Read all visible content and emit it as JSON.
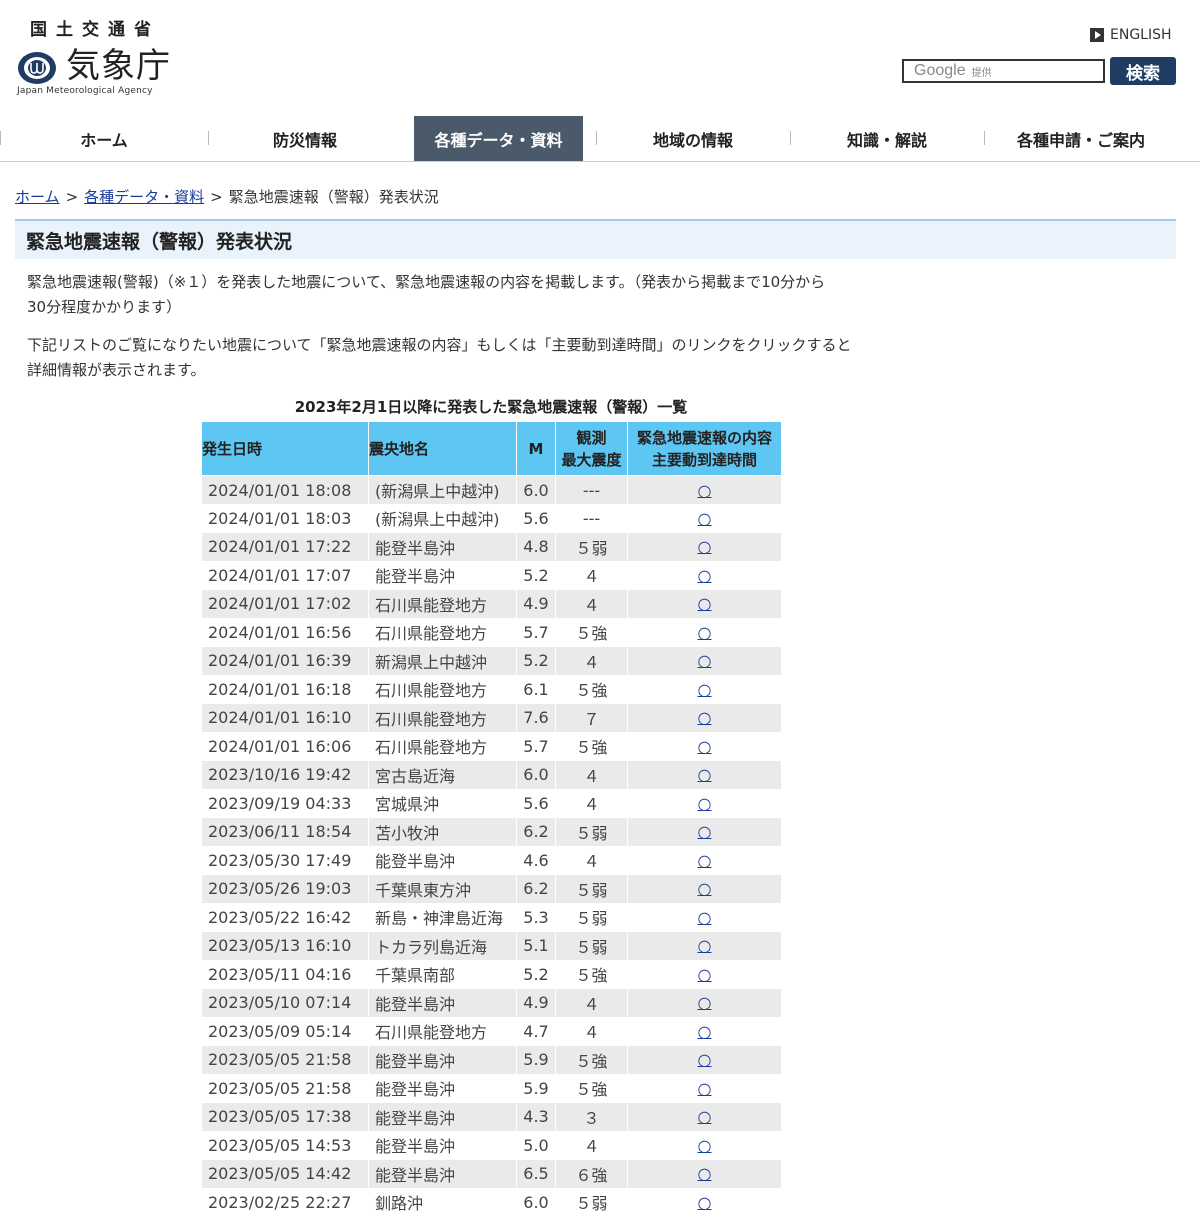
{
  "header": {
    "ministry": "国土交通省",
    "agency_name": "気象庁",
    "agency_en": "Japan Meteorological Agency",
    "english_label": "ENGLISH",
    "search": {
      "google_word": "Google",
      "google_sub": "提供",
      "button_label": "検索"
    },
    "colors": {
      "logo": "#1f3d63",
      "search_button": "#1f3d63"
    }
  },
  "nav": {
    "items": [
      {
        "label": "ホーム"
      },
      {
        "label": "防災情報"
      },
      {
        "label": "各種データ・資料"
      },
      {
        "label": "地域の情報"
      },
      {
        "label": "知識・解説"
      },
      {
        "label": "各種申請・ご案内"
      }
    ],
    "active_index": 2,
    "active_color": "#4b5a6b"
  },
  "breadcrumb": {
    "home": "ホーム",
    "sep1": ">",
    "data": "各種データ・資料",
    "sep2": ">",
    "current": "緊急地震速報（警報）発表状況"
  },
  "page": {
    "title": "緊急地震速報（警報）発表状況",
    "para1_line1": "緊急地震速報(警報)（※１）を発表した地震について、緊急地震速報の内容を掲載します。（発表から掲載まで10分から",
    "para1_line2": "30分程度かかります）",
    "para2_line1": "下記リストのご覧になりたい地震について「緊急地震速報の内容」もしくは「主要動到達時間」のリンクをクリックすると",
    "para2_line2": "詳細情報が表示されます。"
  },
  "table": {
    "caption": "2023年2月1日以降に発表した緊急地震速報（警報）一覧",
    "header_color": "#5ec6f2",
    "headers": {
      "datetime": "発生日時",
      "epicenter": "震央地名",
      "magnitude": "M",
      "intensity_line1": "観測",
      "intensity_line2": "最大震度",
      "link_line1": "緊急地震速報の内容",
      "link_line2": "主要動到達時間"
    },
    "rows": [
      {
        "datetime": "2024/01/01 18:08",
        "epicenter": "(新潟県上中越沖)",
        "m": "6.0",
        "intensity": "---",
        "link": "○"
      },
      {
        "datetime": "2024/01/01 18:03",
        "epicenter": "(新潟県上中越沖)",
        "m": "5.6",
        "intensity": "---",
        "link": "○"
      },
      {
        "datetime": "2024/01/01 17:22",
        "epicenter": "能登半島沖",
        "m": "4.8",
        "intensity": "５弱",
        "link": "○"
      },
      {
        "datetime": "2024/01/01 17:07",
        "epicenter": "能登半島沖",
        "m": "5.2",
        "intensity": "４",
        "link": "○"
      },
      {
        "datetime": "2024/01/01 17:02",
        "epicenter": "石川県能登地方",
        "m": "4.9",
        "intensity": "４",
        "link": "○"
      },
      {
        "datetime": "2024/01/01 16:56",
        "epicenter": "石川県能登地方",
        "m": "5.7",
        "intensity": "５強",
        "link": "○"
      },
      {
        "datetime": "2024/01/01 16:39",
        "epicenter": "新潟県上中越沖",
        "m": "5.2",
        "intensity": "４",
        "link": "○"
      },
      {
        "datetime": "2024/01/01 16:18",
        "epicenter": "石川県能登地方",
        "m": "6.1",
        "intensity": "５強",
        "link": "○"
      },
      {
        "datetime": "2024/01/01 16:10",
        "epicenter": "石川県能登地方",
        "m": "7.6",
        "intensity": "７",
        "link": "○"
      },
      {
        "datetime": "2024/01/01 16:06",
        "epicenter": "石川県能登地方",
        "m": "5.7",
        "intensity": "５強",
        "link": "○"
      },
      {
        "datetime": "2023/10/16 19:42",
        "epicenter": "宮古島近海",
        "m": "6.0",
        "intensity": "４",
        "link": "○"
      },
      {
        "datetime": "2023/09/19 04:33",
        "epicenter": "宮城県沖",
        "m": "5.6",
        "intensity": "４",
        "link": "○"
      },
      {
        "datetime": "2023/06/11 18:54",
        "epicenter": "苫小牧沖",
        "m": "6.2",
        "intensity": "５弱",
        "link": "○"
      },
      {
        "datetime": "2023/05/30 17:49",
        "epicenter": "能登半島沖",
        "m": "4.6",
        "intensity": "４",
        "link": "○"
      },
      {
        "datetime": "2023/05/26 19:03",
        "epicenter": "千葉県東方沖",
        "m": "6.2",
        "intensity": "５弱",
        "link": "○"
      },
      {
        "datetime": "2023/05/22 16:42",
        "epicenter": "新島・神津島近海",
        "m": "5.3",
        "intensity": "５弱",
        "link": "○"
      },
      {
        "datetime": "2023/05/13 16:10",
        "epicenter": "トカラ列島近海",
        "m": "5.1",
        "intensity": "５弱",
        "link": "○"
      },
      {
        "datetime": "2023/05/11 04:16",
        "epicenter": "千葉県南部",
        "m": "5.2",
        "intensity": "５強",
        "link": "○"
      },
      {
        "datetime": "2023/05/10 07:14",
        "epicenter": "能登半島沖",
        "m": "4.9",
        "intensity": "４",
        "link": "○"
      },
      {
        "datetime": "2023/05/09 05:14",
        "epicenter": "石川県能登地方",
        "m": "4.7",
        "intensity": "４",
        "link": "○"
      },
      {
        "datetime": "2023/05/05 21:58",
        "epicenter": "能登半島沖",
        "m": "5.9",
        "intensity": "５強",
        "link": "○"
      },
      {
        "datetime": "2023/05/05 21:58",
        "epicenter": "能登半島沖",
        "m": "5.9",
        "intensity": "５強",
        "link": "○"
      },
      {
        "datetime": "2023/05/05 17:38",
        "epicenter": "能登半島沖",
        "m": "4.3",
        "intensity": "３",
        "link": "○"
      },
      {
        "datetime": "2023/05/05 14:53",
        "epicenter": "能登半島沖",
        "m": "5.0",
        "intensity": "４",
        "link": "○"
      },
      {
        "datetime": "2023/05/05 14:42",
        "epicenter": "能登半島沖",
        "m": "6.5",
        "intensity": "６強",
        "link": "○"
      },
      {
        "datetime": "2023/02/25 22:27",
        "epicenter": "釧路沖",
        "m": "6.0",
        "intensity": "５弱",
        "link": "○"
      }
    ]
  }
}
